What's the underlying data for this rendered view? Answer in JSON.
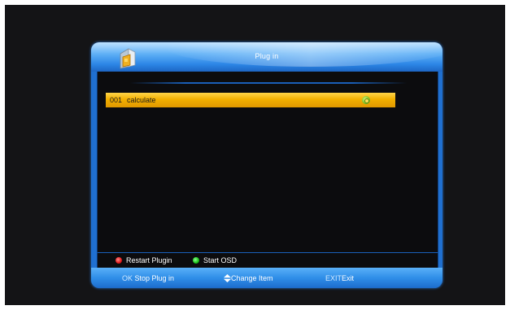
{
  "window": {
    "title": "Plug in",
    "icon": "plugin-folder-icon"
  },
  "plugins": [
    {
      "number": "001",
      "name": "calculate",
      "status_icon": "active-status-icon",
      "selected": true
    }
  ],
  "legend": {
    "red": {
      "label": "Restart Plugin",
      "color": "#e01818"
    },
    "green": {
      "label": "Start OSD",
      "color": "#18c018"
    }
  },
  "footer": {
    "ok": {
      "key": "OK",
      "label": "Stop Plug in"
    },
    "updown": {
      "icon": "up-down-arrow-icon",
      "label": "Change Item"
    },
    "exit": {
      "key": "EXIT",
      "label": "Exit"
    }
  },
  "colors": {
    "frame_blue": "#2f8ee8",
    "highlight_yellow": "#f3b000",
    "content_bg": "#0c0c0e"
  }
}
